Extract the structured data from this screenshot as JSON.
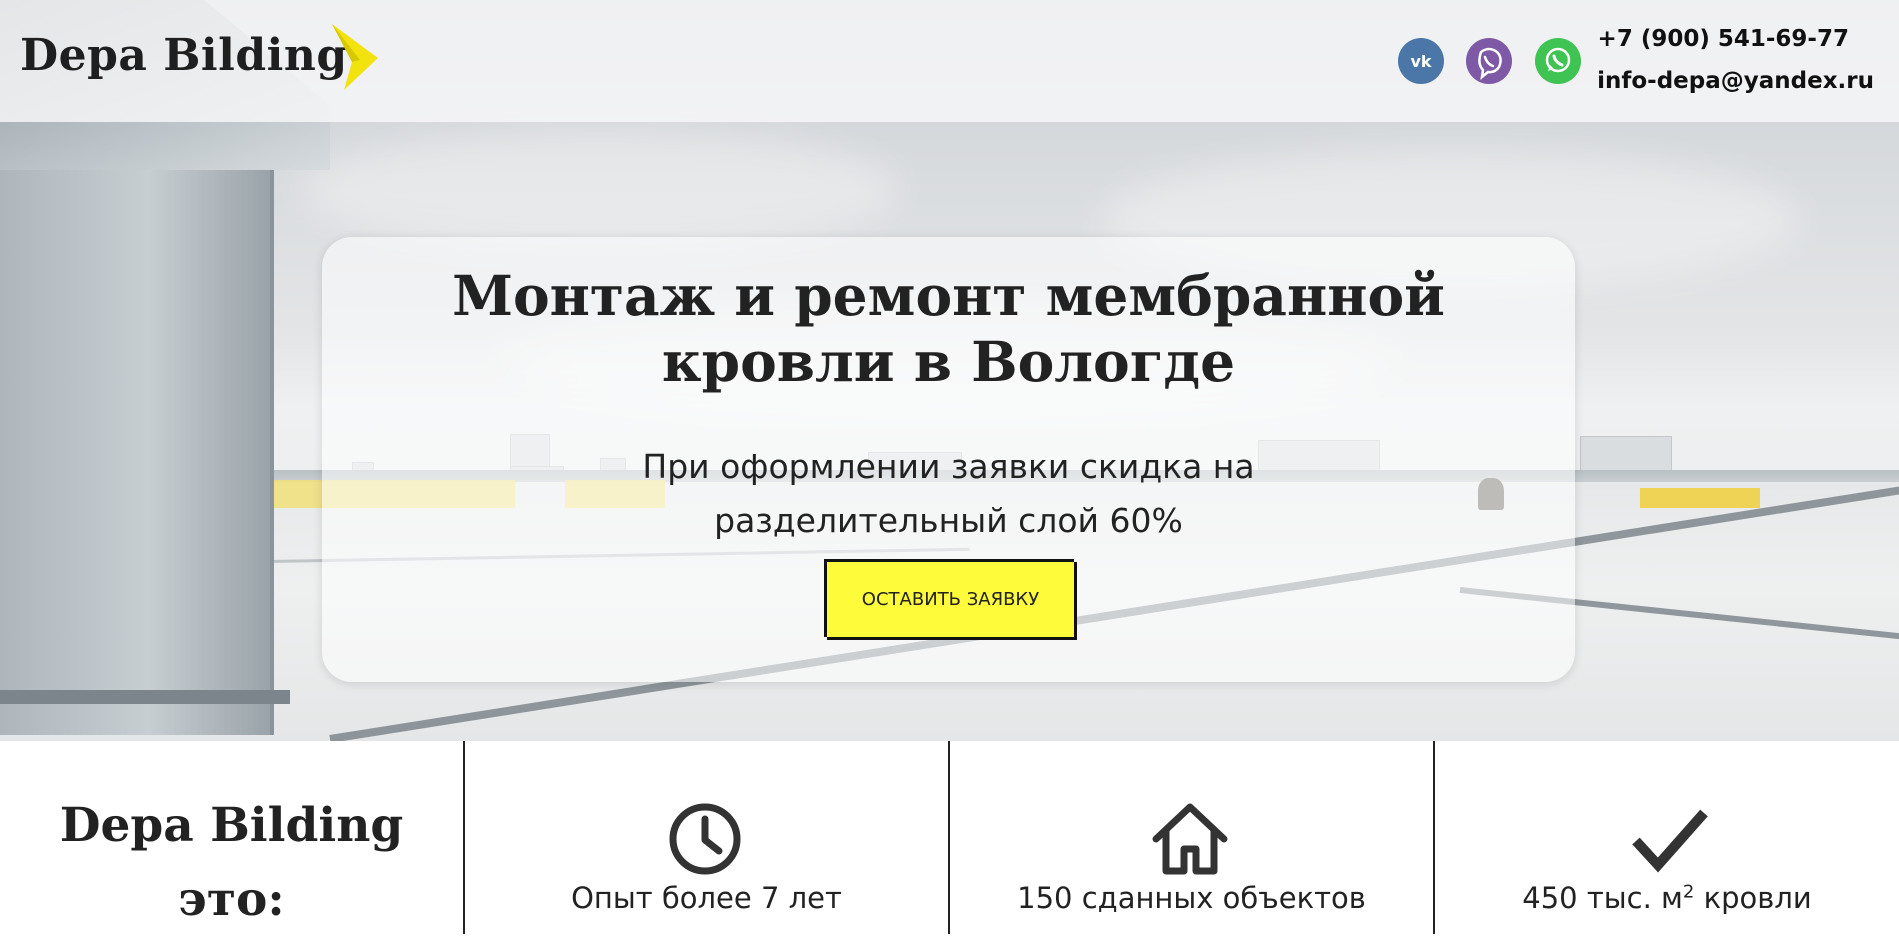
{
  "brand": {
    "name": "Depa Bilding",
    "accent_color": "#f2e30f"
  },
  "header": {
    "social": [
      {
        "name": "vk",
        "icon": "vk-icon",
        "color": "#4a76a8"
      },
      {
        "name": "viber",
        "icon": "viber-icon",
        "color": "#7d59a6"
      },
      {
        "name": "whatsapp",
        "icon": "whatsapp-icon",
        "color": "#3fc352"
      }
    ],
    "phone": "+7 (900) 541-69-77",
    "email": "info-depa@yandex.ru"
  },
  "hero": {
    "title_line1": "Монтаж и ремонт мембранной",
    "title_line2": "кровли в Вологде",
    "subtitle_line1": "При оформлении заявки скидка на",
    "subtitle_line2": "разделительный слой 60%",
    "cta_label": "ОСТАВИТЬ ЗАЯВКУ",
    "cta_color": "#fdfb3a"
  },
  "stats": {
    "about_line1": "Depa Bilding",
    "about_line2": "это:",
    "items": [
      {
        "icon": "clock-icon",
        "label": "Опыт более 7 лет"
      },
      {
        "icon": "home-icon",
        "label": "150 сданных объектов"
      },
      {
        "icon": "checkmark-icon",
        "label_prefix": "450 тыс. м",
        "label_sup": "2",
        "label_suffix": " кровли"
      }
    ]
  }
}
